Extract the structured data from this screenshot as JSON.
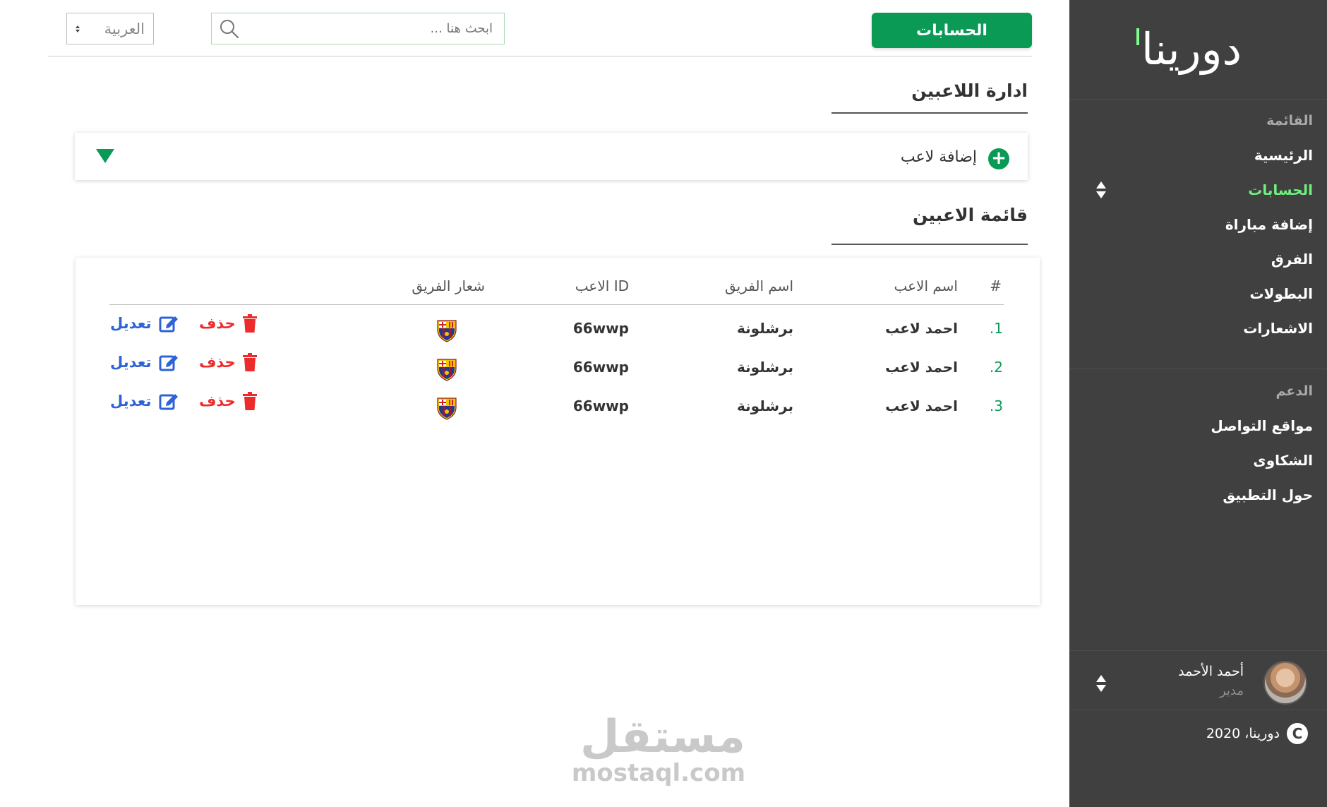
{
  "sidebar": {
    "logo": "دورينا",
    "menu_title": "القائمة",
    "menu_items": [
      {
        "label": "الرئيسية",
        "active": false
      },
      {
        "label": "الحسابات",
        "active": true
      },
      {
        "label": "إضافة مباراة",
        "active": false
      },
      {
        "label": "الفرق",
        "active": false
      },
      {
        "label": "البطولات",
        "active": false
      },
      {
        "label": "الاشعارات",
        "active": false
      }
    ],
    "support_title": "الدعم",
    "support_items": [
      {
        "label": "مواقع التواصل"
      },
      {
        "label": "الشكاوى"
      },
      {
        "label": "حول التطبيق"
      }
    ],
    "user": {
      "name": "أحمد الأحمد",
      "role": "مدير"
    },
    "copyright": "دورينا، 2020",
    "copyright_symbol": "C"
  },
  "topbar": {
    "accounts_button": "الحسابات",
    "search_placeholder": "ابحث هنا ...",
    "language": "العربية"
  },
  "main": {
    "manage_title": "ادارة اللاعبين",
    "add_player_label": "إضافة لاعب",
    "list_title": "قائمة الاعبين",
    "table": {
      "headers": {
        "index": "#",
        "player_name": "اسم الاعب",
        "team_name": "اسم الفريق",
        "player_id": "ID  الاعب",
        "team_logo": "شعار الفريق"
      },
      "rows": [
        {
          "index": "1.",
          "player_name": "احمد لاعب",
          "team_name": "برشلونة",
          "player_id": "66wwp",
          "delete": "حذف",
          "edit": "تعديل"
        },
        {
          "index": "2.",
          "player_name": "احمد لاعب",
          "team_name": "برشلونة",
          "player_id": "66wwp",
          "delete": "حذف",
          "edit": "تعديل"
        },
        {
          "index": "3.",
          "player_name": "احمد لاعب",
          "team_name": "برشلونة",
          "player_id": "66wwp",
          "delete": "حذف",
          "edit": "تعديل"
        }
      ]
    }
  },
  "watermark": {
    "arabic": "مستقل",
    "latin": "mostaql.com"
  },
  "colors": {
    "brand_green": "#0a9a56",
    "sidebar_bg": "#404040",
    "active_menu": "#6ff07e",
    "delete_red": "#ee2b2b",
    "edit_blue": "#2d62d8"
  }
}
